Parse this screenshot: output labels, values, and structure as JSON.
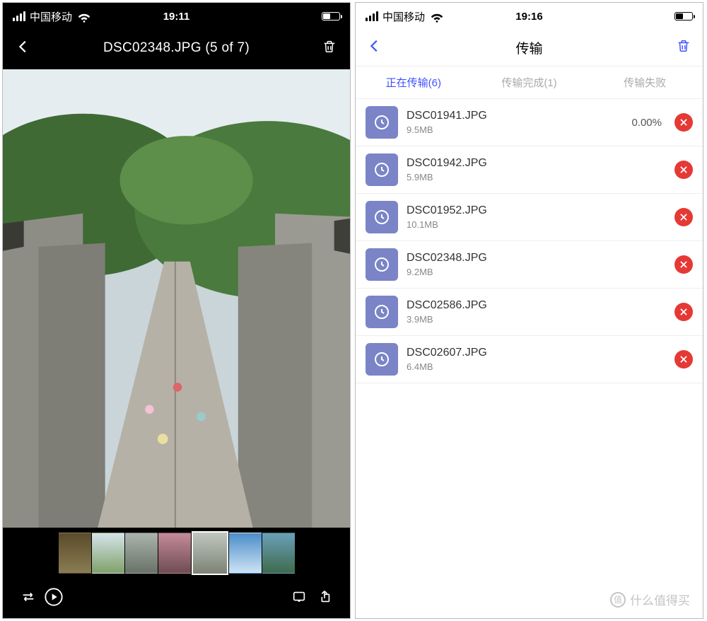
{
  "left": {
    "status": {
      "carrier": "中国移动",
      "time": "19:11"
    },
    "title": "DSC02348.JPG (5 of 7)",
    "thumb_count": 7,
    "selected_index": 4
  },
  "right": {
    "status": {
      "carrier": "中国移动",
      "time": "19:16"
    },
    "title": "传输",
    "tabs": {
      "inprogress": "正在传输(6)",
      "done": "传输完成(1)",
      "failed": "传输失败"
    },
    "items": [
      {
        "name": "DSC01941.JPG",
        "size": "9.5MB",
        "percent": "0.00%"
      },
      {
        "name": "DSC01942.JPG",
        "size": "5.9MB",
        "percent": ""
      },
      {
        "name": "DSC01952.JPG",
        "size": "10.1MB",
        "percent": ""
      },
      {
        "name": "DSC02348.JPG",
        "size": "9.2MB",
        "percent": ""
      },
      {
        "name": "DSC02586.JPG",
        "size": "3.9MB",
        "percent": ""
      },
      {
        "name": "DSC02607.JPG",
        "size": "6.4MB",
        "percent": ""
      }
    ]
  },
  "watermark": {
    "badge": "值",
    "text": "什么值得买"
  }
}
